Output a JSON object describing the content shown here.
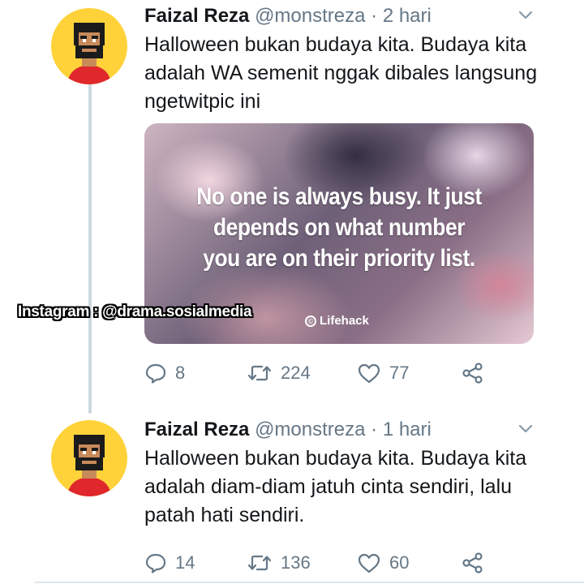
{
  "watermark": "Instagram : @drama.sosialmedia",
  "tweets": [
    {
      "name": "Faizal Reza",
      "handle": "@monstreza",
      "separator": "·",
      "time": "2 hari",
      "text": "Halloween bukan budaya kita. Budaya kita adalah WA semenit nggak dibales langsung ngetwitpic ini",
      "media": {
        "quote": "No one is always busy. It just depends on what number you are on their priority list.",
        "brand": "Lifehack",
        "brand_icon": "lifehack-logo-icon"
      },
      "replies": "8",
      "retweets": "224",
      "likes": "77"
    },
    {
      "name": "Faizal Reza",
      "handle": "@monstreza",
      "separator": "·",
      "time": "1 hari",
      "text": "Halloween bukan budaya kita. Budaya kita adalah diam-diam jatuh cinta sendiri, lalu patah hati sendiri.",
      "replies": "14",
      "retweets": "136",
      "likes": "60"
    }
  ],
  "icons": {
    "reply": "reply-icon",
    "retweet": "retweet-icon",
    "like": "heart-icon",
    "share": "share-icon",
    "caret": "chevron-down-icon"
  },
  "colors": {
    "avatar_bg": "#ffd23a",
    "muted": "#657786",
    "thread_line": "#cdd8e0",
    "text": "#14171a"
  }
}
